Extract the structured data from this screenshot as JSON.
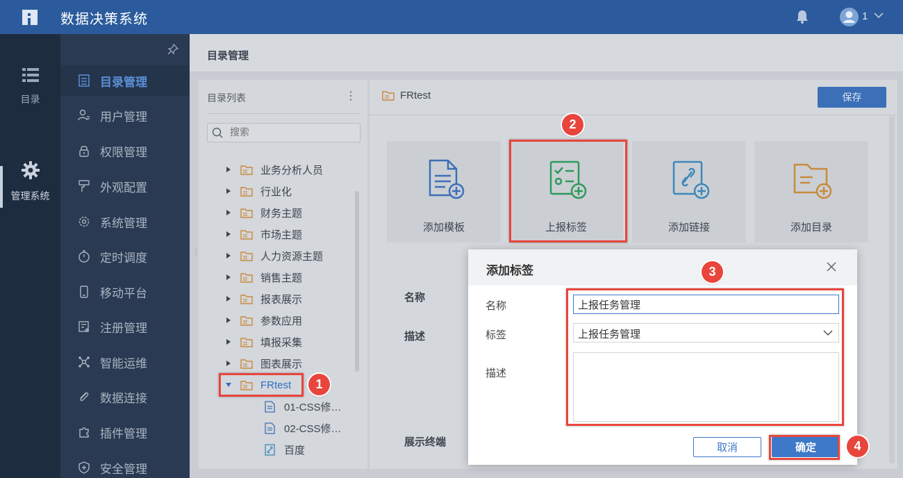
{
  "app": {
    "title": "数据决策系统",
    "user": "1"
  },
  "rail": {
    "items": [
      {
        "label": "目录"
      },
      {
        "label": "管理系统"
      }
    ]
  },
  "menu": {
    "items": [
      {
        "label": "目录管理"
      },
      {
        "label": "用户管理"
      },
      {
        "label": "权限管理"
      },
      {
        "label": "外观配置"
      },
      {
        "label": "系统管理"
      },
      {
        "label": "定时调度"
      },
      {
        "label": "移动平台"
      },
      {
        "label": "注册管理"
      },
      {
        "label": "智能运维"
      },
      {
        "label": "数据连接"
      },
      {
        "label": "插件管理"
      },
      {
        "label": "安全管理"
      }
    ]
  },
  "breadcrumb": "目录管理",
  "tree": {
    "header": "目录列表",
    "more": "⋮",
    "search_placeholder": "搜索",
    "folders": [
      "业务分析人员",
      "行业化",
      "财务主题",
      "市场主题",
      "人力资源主题",
      "销售主题",
      "报表展示",
      "参数应用",
      "填报采集",
      "图表展示"
    ],
    "selected": "FRtest",
    "children": [
      "01-CSS修…",
      "02-CSS修…",
      "百度"
    ]
  },
  "main": {
    "title": "FRtest",
    "save_label": "保存",
    "cards": [
      {
        "label": "添加模板"
      },
      {
        "label": "上报标签"
      },
      {
        "label": "添加链接"
      },
      {
        "label": "添加目录"
      }
    ],
    "field_labels": {
      "name": "名称",
      "desc": "描述",
      "terminal": "展示终端"
    }
  },
  "dialog": {
    "title": "添加标签",
    "name_label": "名称",
    "name_value": "上报任务管理",
    "tag_label": "标签",
    "tag_value": "上报任务管理",
    "desc_label": "描述",
    "desc_value": "",
    "cancel_label": "取消",
    "ok_label": "确定"
  },
  "annotations": [
    "1",
    "2",
    "3",
    "4"
  ],
  "colors": {
    "accent": "#3d78c9",
    "highlight": "#e8453c",
    "topbar": "#2b5b9c"
  }
}
